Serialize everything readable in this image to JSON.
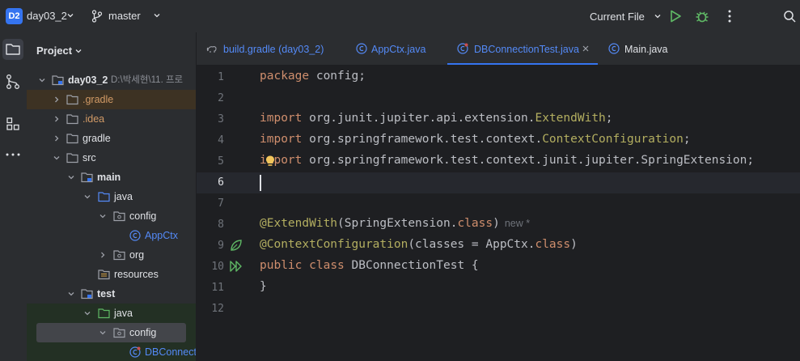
{
  "titlebar": {
    "project_badge": "D2",
    "project_name": "day03_2",
    "branch": "master",
    "run_config": "Current File"
  },
  "project_panel": {
    "title": "Project",
    "tree": [
      {
        "label": "day03_2",
        "path_hint": "D:\\박세현\\11. 프로",
        "bold": true
      },
      {
        "label": ".gradle"
      },
      {
        "label": ".idea"
      },
      {
        "label": "gradle"
      },
      {
        "label": "src"
      },
      {
        "label": "main",
        "bold": true
      },
      {
        "label": "java"
      },
      {
        "label": "config"
      },
      {
        "label": "AppCtx"
      },
      {
        "label": "org"
      },
      {
        "label": "resources"
      },
      {
        "label": "test",
        "bold": true
      },
      {
        "label": "java"
      },
      {
        "label": "config"
      },
      {
        "label": "DBConnectionTest"
      }
    ]
  },
  "tabs": [
    {
      "label": "build.gradle (day03_2)"
    },
    {
      "label": "AppCtx.java"
    },
    {
      "label": "DBConnectionTest.java",
      "active": true
    },
    {
      "label": "Main.java"
    }
  ],
  "editor": {
    "line_numbers": [
      "1",
      "2",
      "3",
      "4",
      "5",
      "6",
      "7",
      "8",
      "9",
      "10",
      "11",
      "12"
    ],
    "lines": {
      "l1_kw": "package",
      "l1_rest": " config;",
      "l3_kw": "import",
      "l3_rest": " org.junit.jupiter.api.extension.",
      "l3_cls": "ExtendWith",
      "l3_end": ";",
      "l4_kw": "import",
      "l4_rest": " org.springframework.test.context.",
      "l4_cls": "ContextConfiguration",
      "l4_end": ";",
      "l5_kw": "import",
      "l5_rest": " org.springframework.test.context.junit.jupiter.SpringExtension;",
      "l8_ann": "@ExtendWith",
      "l8_rest": "(SpringExtension.",
      "l8_kw": "class",
      "l8_end": ")",
      "l8_hint": "new *",
      "l9_ann": "@ContextConfiguration",
      "l9_rest": "(classes = AppCtx.",
      "l9_kw": "class",
      "l9_end": ")",
      "l10_kw1": "public",
      "l10_kw2": "class",
      "l10_rest": " DBConnectionTest {",
      "l11": "}"
    }
  }
}
